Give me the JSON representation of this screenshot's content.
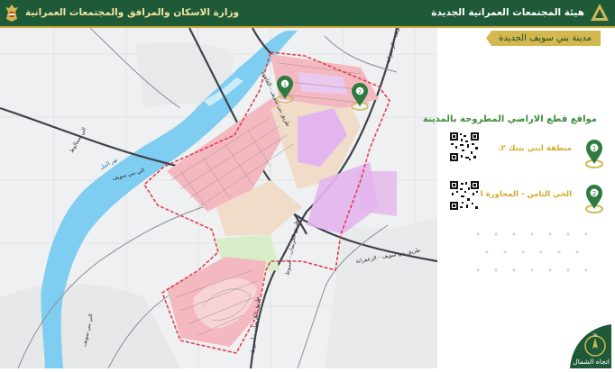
{
  "header": {
    "ministry": "وزارة الاسكان والمرافق والمجتمعات العمرانية",
    "authority": "هيئة المجتمعات العمرانية الجديدة"
  },
  "city_tab": "مدينة بني سويف الجديدة",
  "panel": {
    "title": "مواقع قطع الاراضي المطروحة بالمدينة",
    "locations": [
      {
        "number": "1",
        "label": "منطقة ابني بيتك ٢."
      },
      {
        "number": "2",
        "label": "الحي الثامن - المجاورة الثانية."
      }
    ]
  },
  "map": {
    "roads": {
      "r1": "طريق بني سويف - الزعفرانة",
      "r2": "طريق بني سويف - الزعفرانة",
      "r3": "طريق الكريمات - أسيوط",
      "r4": "طريق الكريمات - أسيوط",
      "r5": "طريق بني سويف - القاهرة",
      "r6": "الي بني سويف",
      "r7": "الي بني سويف",
      "r8": "الي سمالوط",
      "river": "نهر النيل"
    },
    "markers": [
      "1",
      "2"
    ],
    "colors": {
      "river": "#7fcdf0",
      "boundary": "#e04050",
      "zone_pink": "#f4b8c0",
      "zone_violet": "#e3b5ee",
      "zone_tan": "#f1dcc9",
      "zone_green": "#d7eec8",
      "road": "#3f4348",
      "brand_green": "#1f5a38",
      "brand_gold": "#d2b84e"
    }
  },
  "compass": {
    "letter": "N",
    "caption": "اتجاه الشمال"
  }
}
